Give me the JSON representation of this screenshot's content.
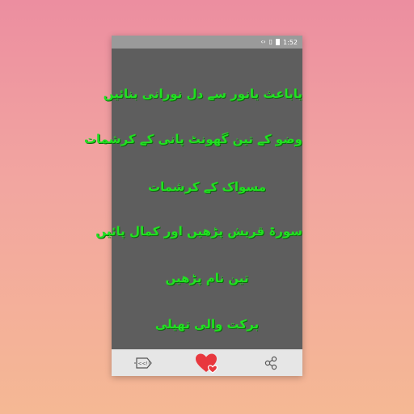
{
  "status_bar": {
    "time": "1:52"
  },
  "items": [
    {
      "label": "یاباعث یانور سے دل نورانی بنائیں"
    },
    {
      "label": "وضو کے تین گھونٹ پانی کے کرشمات"
    },
    {
      "label": "مسواک کے کرشمات"
    },
    {
      "label": "سورۃ قریش پڑھیں اور کمال پائیں"
    },
    {
      "label": "تین نام پڑھیں"
    },
    {
      "label": "برکت والی تھیلی"
    }
  ],
  "bottom_bar": {
    "more_apps_label": "<<!!",
    "icons": [
      "more-apps-icon",
      "favorite-heart-icon",
      "share-icon"
    ]
  },
  "colors": {
    "item_text": "#22e022",
    "list_background": "#5e5e5e",
    "heart": "#e8383e"
  }
}
